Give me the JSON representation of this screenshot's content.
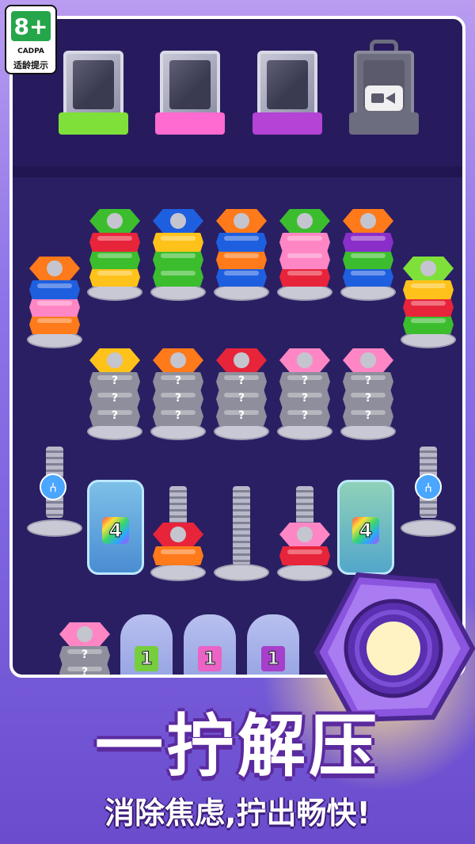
{
  "age_rating": {
    "rating": "8+",
    "org": "CADPA",
    "label": "适龄提示"
  },
  "colors": {
    "orange": "#ff7a1a",
    "red": "#e8243a",
    "yellow": "#ffc21a",
    "green": "#3cbd2e",
    "blue": "#1e5fe0",
    "pink": "#ff86c4",
    "purple": "#8a2ec9",
    "gray": "#8e8e9c",
    "lime": "#7fe03a",
    "magenta": "#ff6bd0",
    "violet": "#b443d6"
  },
  "boxes": [
    {
      "base_color": "#7fe03a",
      "locked": false
    },
    {
      "base_color": "#ff6bd0",
      "locked": false
    },
    {
      "base_color": "#b443d6",
      "locked": false
    },
    {
      "base_color": "#6d6d80",
      "locked": true,
      "icon": "video-icon"
    }
  ],
  "hidden_nut_symbol": "?",
  "ice_counters": [
    "4",
    "4"
  ],
  "ghost_counters": [
    {
      "value": "1",
      "color": "#7fe03a"
    },
    {
      "value": "1",
      "color": "#ff6bd0"
    },
    {
      "value": "1",
      "color": "#b443d6"
    }
  ],
  "share_icon": "share-icon",
  "headline": "一拧解压",
  "tagline": "消除焦虑,拧出畅快!"
}
